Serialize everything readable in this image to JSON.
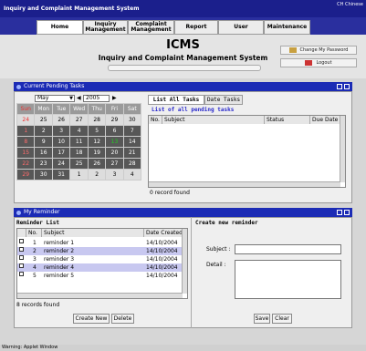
{
  "window": {
    "title": "Inquiry and Complaint Management System",
    "lang": "CH Chinese"
  },
  "nav": [
    {
      "label": "Home"
    },
    {
      "label": "Inquiry Management"
    },
    {
      "label": "Complaint Management"
    },
    {
      "label": "Report"
    },
    {
      "label": "User"
    },
    {
      "label": "Maintenance"
    }
  ],
  "banner": {
    "title": "ICMS",
    "subtitle": "Inquiry and Complaint Management System",
    "change_password": "Change My Password",
    "logout": "Logout"
  },
  "pending": {
    "header": "Current Pending Tasks",
    "calendar": {
      "month": "May",
      "year": "2005",
      "weekdays": [
        "Sun",
        "Mon",
        "Tue",
        "Wed",
        "Thu",
        "Fri",
        "Sat"
      ],
      "weeks": [
        [
          "24",
          "25",
          "26",
          "27",
          "28",
          "29",
          "30"
        ],
        [
          "1",
          "2",
          "3",
          "4",
          "5",
          "6",
          "7"
        ],
        [
          "8",
          "9",
          "10",
          "11",
          "12",
          "13",
          "14"
        ],
        [
          "15",
          "16",
          "17",
          "18",
          "19",
          "20",
          "21"
        ],
        [
          "22",
          "23",
          "24",
          "25",
          "26",
          "27",
          "28"
        ],
        [
          "29",
          "30",
          "31",
          "1",
          "2",
          "3",
          "4"
        ]
      ]
    },
    "tabs": [
      "List All Tasks",
      "Date Tasks"
    ],
    "list_title": "List of all pending tasks",
    "columns": [
      "No.",
      "Subject",
      "Status",
      "Due Date"
    ],
    "footer": "0 record found"
  },
  "reminder": {
    "header": "My Reminder",
    "list_title": "Reminder List",
    "columns": [
      "No.",
      "Subject",
      "Date Created"
    ],
    "rows": [
      {
        "no": "1",
        "subject": "reminder 1",
        "date": "14/10/2004"
      },
      {
        "no": "2",
        "subject": "reminder 2",
        "date": "14/10/2004"
      },
      {
        "no": "3",
        "subject": "reminder 3",
        "date": "14/10/2004"
      },
      {
        "no": "4",
        "subject": "reminder 4",
        "date": "14/10/2004"
      },
      {
        "no": "5",
        "subject": "reminder 5",
        "date": "14/10/2004"
      }
    ],
    "footer": "8 records found",
    "create_new": "Create New",
    "delete": "Delete",
    "create_title": "Create new reminder",
    "subject_label": "Subject :",
    "detail_label": "Detail :",
    "save": "Save",
    "clear": "Clear"
  },
  "status": "Warning: Applet Window"
}
